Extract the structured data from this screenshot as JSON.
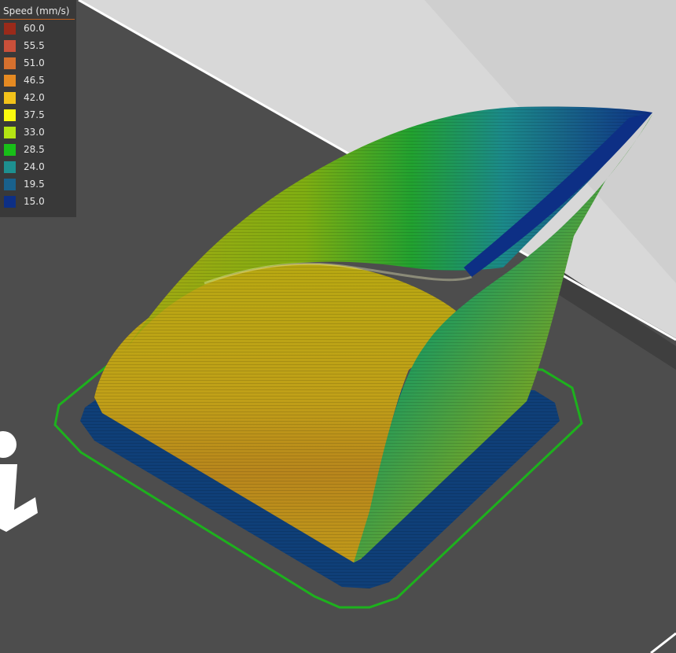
{
  "legend": {
    "title": "Speed (mm/s)",
    "items": [
      {
        "label": "60.0",
        "color": "#9a2a1a"
      },
      {
        "label": "55.5",
        "color": "#c9503a"
      },
      {
        "label": "51.0",
        "color": "#d5702e"
      },
      {
        "label": "46.5",
        "color": "#e58a22"
      },
      {
        "label": "42.0",
        "color": "#f2c21a"
      },
      {
        "label": "37.5",
        "color": "#fafa0e"
      },
      {
        "label": "33.0",
        "color": "#b4e413"
      },
      {
        "label": "28.5",
        "color": "#18bf18"
      },
      {
        "label": "24.0",
        "color": "#1d9090"
      },
      {
        "label": "19.5",
        "color": "#19618c"
      },
      {
        "label": "15.0",
        "color": "#0d2f85"
      }
    ]
  },
  "scene": {
    "bed_color": "#4d4d4d",
    "background_color": "#d8d8d8",
    "skirt_color": "#1db11d",
    "bed_edge_color": "#ffffff"
  }
}
